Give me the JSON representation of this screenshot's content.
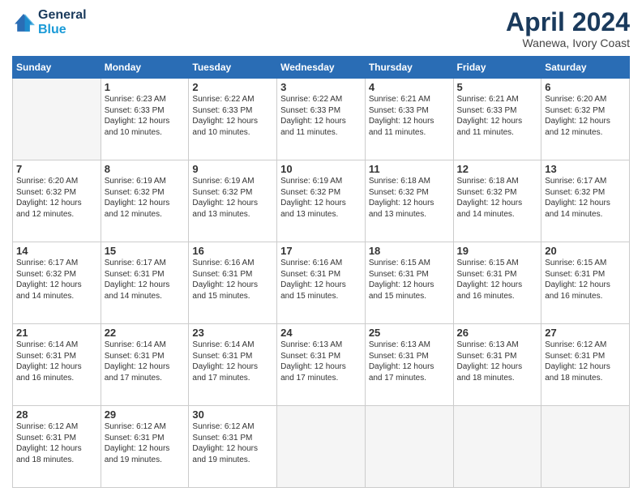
{
  "header": {
    "logo_line1": "General",
    "logo_line2": "Blue",
    "title": "April 2024",
    "subtitle": "Wanewa, Ivory Coast"
  },
  "calendar": {
    "days_of_week": [
      "Sunday",
      "Monday",
      "Tuesday",
      "Wednesday",
      "Thursday",
      "Friday",
      "Saturday"
    ],
    "weeks": [
      [
        {
          "day": "",
          "info": ""
        },
        {
          "day": "1",
          "info": "Sunrise: 6:23 AM\nSunset: 6:33 PM\nDaylight: 12 hours\nand 10 minutes."
        },
        {
          "day": "2",
          "info": "Sunrise: 6:22 AM\nSunset: 6:33 PM\nDaylight: 12 hours\nand 10 minutes."
        },
        {
          "day": "3",
          "info": "Sunrise: 6:22 AM\nSunset: 6:33 PM\nDaylight: 12 hours\nand 11 minutes."
        },
        {
          "day": "4",
          "info": "Sunrise: 6:21 AM\nSunset: 6:33 PM\nDaylight: 12 hours\nand 11 minutes."
        },
        {
          "day": "5",
          "info": "Sunrise: 6:21 AM\nSunset: 6:33 PM\nDaylight: 12 hours\nand 11 minutes."
        },
        {
          "day": "6",
          "info": "Sunrise: 6:20 AM\nSunset: 6:32 PM\nDaylight: 12 hours\nand 12 minutes."
        }
      ],
      [
        {
          "day": "7",
          "info": "Sunrise: 6:20 AM\nSunset: 6:32 PM\nDaylight: 12 hours\nand 12 minutes."
        },
        {
          "day": "8",
          "info": "Sunrise: 6:19 AM\nSunset: 6:32 PM\nDaylight: 12 hours\nand 12 minutes."
        },
        {
          "day": "9",
          "info": "Sunrise: 6:19 AM\nSunset: 6:32 PM\nDaylight: 12 hours\nand 13 minutes."
        },
        {
          "day": "10",
          "info": "Sunrise: 6:19 AM\nSunset: 6:32 PM\nDaylight: 12 hours\nand 13 minutes."
        },
        {
          "day": "11",
          "info": "Sunrise: 6:18 AM\nSunset: 6:32 PM\nDaylight: 12 hours\nand 13 minutes."
        },
        {
          "day": "12",
          "info": "Sunrise: 6:18 AM\nSunset: 6:32 PM\nDaylight: 12 hours\nand 14 minutes."
        },
        {
          "day": "13",
          "info": "Sunrise: 6:17 AM\nSunset: 6:32 PM\nDaylight: 12 hours\nand 14 minutes."
        }
      ],
      [
        {
          "day": "14",
          "info": "Sunrise: 6:17 AM\nSunset: 6:32 PM\nDaylight: 12 hours\nand 14 minutes."
        },
        {
          "day": "15",
          "info": "Sunrise: 6:17 AM\nSunset: 6:31 PM\nDaylight: 12 hours\nand 14 minutes."
        },
        {
          "day": "16",
          "info": "Sunrise: 6:16 AM\nSunset: 6:31 PM\nDaylight: 12 hours\nand 15 minutes."
        },
        {
          "day": "17",
          "info": "Sunrise: 6:16 AM\nSunset: 6:31 PM\nDaylight: 12 hours\nand 15 minutes."
        },
        {
          "day": "18",
          "info": "Sunrise: 6:15 AM\nSunset: 6:31 PM\nDaylight: 12 hours\nand 15 minutes."
        },
        {
          "day": "19",
          "info": "Sunrise: 6:15 AM\nSunset: 6:31 PM\nDaylight: 12 hours\nand 16 minutes."
        },
        {
          "day": "20",
          "info": "Sunrise: 6:15 AM\nSunset: 6:31 PM\nDaylight: 12 hours\nand 16 minutes."
        }
      ],
      [
        {
          "day": "21",
          "info": "Sunrise: 6:14 AM\nSunset: 6:31 PM\nDaylight: 12 hours\nand 16 minutes."
        },
        {
          "day": "22",
          "info": "Sunrise: 6:14 AM\nSunset: 6:31 PM\nDaylight: 12 hours\nand 17 minutes."
        },
        {
          "day": "23",
          "info": "Sunrise: 6:14 AM\nSunset: 6:31 PM\nDaylight: 12 hours\nand 17 minutes."
        },
        {
          "day": "24",
          "info": "Sunrise: 6:13 AM\nSunset: 6:31 PM\nDaylight: 12 hours\nand 17 minutes."
        },
        {
          "day": "25",
          "info": "Sunrise: 6:13 AM\nSunset: 6:31 PM\nDaylight: 12 hours\nand 17 minutes."
        },
        {
          "day": "26",
          "info": "Sunrise: 6:13 AM\nSunset: 6:31 PM\nDaylight: 12 hours\nand 18 minutes."
        },
        {
          "day": "27",
          "info": "Sunrise: 6:12 AM\nSunset: 6:31 PM\nDaylight: 12 hours\nand 18 minutes."
        }
      ],
      [
        {
          "day": "28",
          "info": "Sunrise: 6:12 AM\nSunset: 6:31 PM\nDaylight: 12 hours\nand 18 minutes."
        },
        {
          "day": "29",
          "info": "Sunrise: 6:12 AM\nSunset: 6:31 PM\nDaylight: 12 hours\nand 19 minutes."
        },
        {
          "day": "30",
          "info": "Sunrise: 6:12 AM\nSunset: 6:31 PM\nDaylight: 12 hours\nand 19 minutes."
        },
        {
          "day": "",
          "info": ""
        },
        {
          "day": "",
          "info": ""
        },
        {
          "day": "",
          "info": ""
        },
        {
          "day": "",
          "info": ""
        }
      ]
    ]
  }
}
